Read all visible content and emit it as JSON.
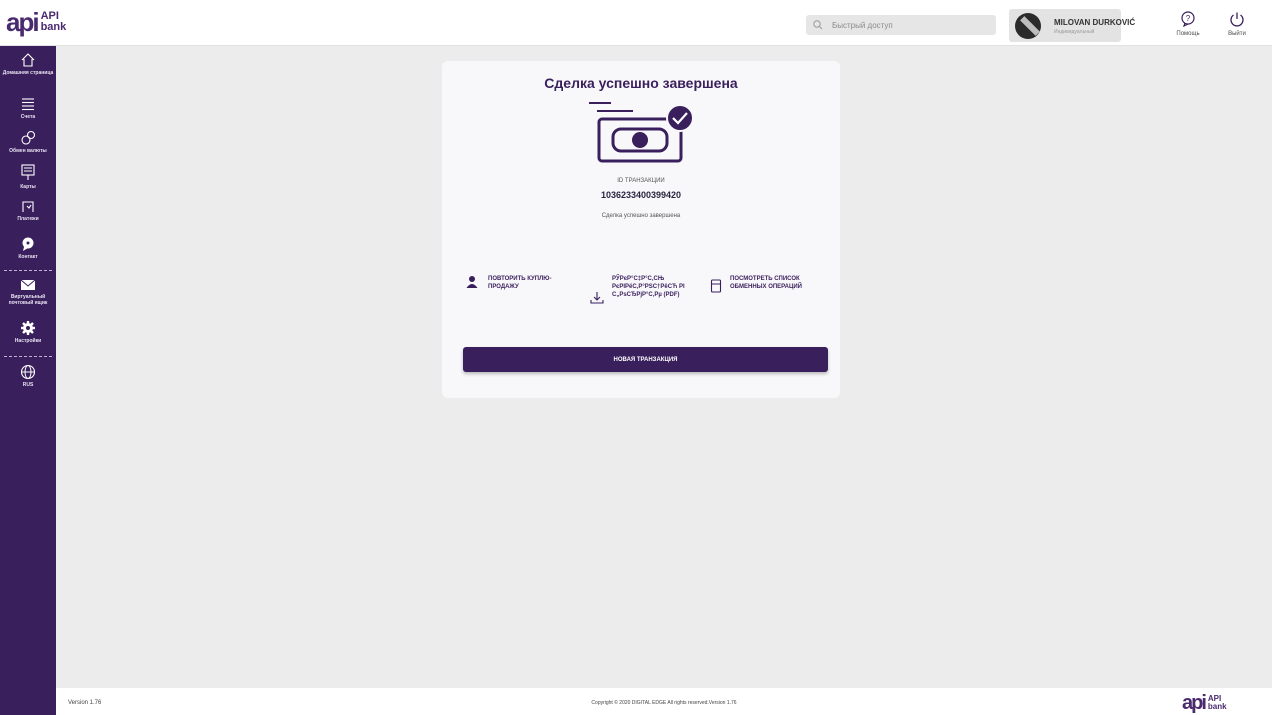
{
  "brand": {
    "mark": "api",
    "line1": "API",
    "line2": "bank"
  },
  "search": {
    "placeholder": "Быстрый доступ"
  },
  "user": {
    "name": "MILOVAN DURKOVIĆ",
    "role": "Индивидуальный"
  },
  "top_actions": {
    "help": "Помощь",
    "logout": "Выйти"
  },
  "sidebar": {
    "items": [
      {
        "label": "Домашняя страница",
        "icon": "home-icon"
      },
      {
        "label": "Счета",
        "icon": "list-icon"
      },
      {
        "label": "Обмен валюты",
        "icon": "currency-exchange-icon"
      },
      {
        "label": "Карты",
        "icon": "cards-icon"
      },
      {
        "label": "Платежи",
        "icon": "payments-icon"
      },
      {
        "label": "Контакт",
        "icon": "contact-icon"
      },
      {
        "label": "Виртуальный почтовый ящик",
        "icon": "mail-icon"
      },
      {
        "label": "Настройки",
        "icon": "settings-icon"
      },
      {
        "label": "RUS",
        "icon": "globe-icon"
      }
    ]
  },
  "main": {
    "title": "Сделка успешно завершена",
    "tx_label": "ID ТРАНЗАКЦИИ",
    "tx_id": "1036233400399420",
    "status": "Сделка успешно завершена",
    "actions": {
      "repeat": "ПОВТОРИТЬ КУПЛЮ-ПРОДАЖУ",
      "download": "РЎРєР°С‡Р°С‚СЊ РєРІРёС‚Р°РЅС†РёСЋ РІ С„РѕСЂРјР°С‚Рµ (PDF)",
      "view_list": "ПОСМОТРЕТЬ СПИСОК ОБМЕННЫХ ОПЕРАЦИЙ"
    },
    "new_tx_button": "НОВАЯ ТРАНЗАКЦИЯ"
  },
  "footer": {
    "version": "Version 1.76",
    "copyright": "Copyright © 2020 DIGITAL EDGE All rights reserved.Version 1.76"
  },
  "colors": {
    "primary": "#3a1f5d",
    "background": "#ececec",
    "card": "#f8f8fa"
  }
}
